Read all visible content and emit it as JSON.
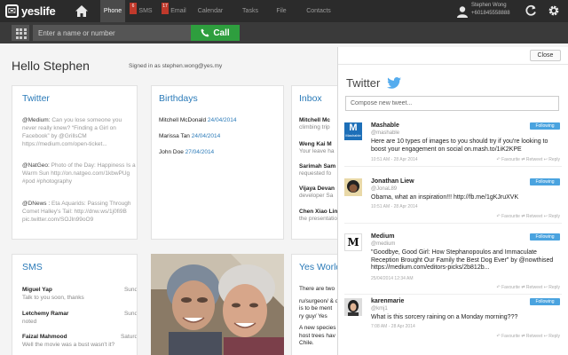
{
  "app": {
    "logo_glyph": "✉",
    "logo_text": "yeslife"
  },
  "nav": {
    "tabs": [
      {
        "label": "Phone",
        "active": true
      },
      {
        "label": "SMS",
        "badge": "6"
      },
      {
        "label": "Email",
        "badge": "17"
      },
      {
        "label": "Calendar"
      },
      {
        "label": "Tasks"
      },
      {
        "label": "File"
      },
      {
        "label": "Contacts"
      }
    ],
    "user_name": "Stephen Wong",
    "user_phone": "+601845558888"
  },
  "callbar": {
    "placeholder": "Enter a name or number",
    "call_label": "Call"
  },
  "greeting": {
    "hello": "Hello Stephen",
    "signed_in": "Signed in as stephen.wong@yes.my"
  },
  "twitter_card": {
    "title": "Twitter",
    "items": [
      {
        "handle": "@Medium:",
        "text": "Can you lose someone you never really knew? “Finding a Girl on Facebook” by @GrillsCM https://medium.com/open-ticket..."
      },
      {
        "handle": "@NatGeo:",
        "text": "Photo of the Day: Happiness Is a Warm Sun http://on.natgeo.com/1kbwPUg #pod #photography"
      },
      {
        "handle": "@DNews :",
        "text": "Eta Aquarids: Passing Through Comet Halley's Tail: http://dnw.ws/1j0fi9B pic.twitter.com/SOJln99oO9"
      }
    ]
  },
  "birthdays": {
    "title": "Birthdays",
    "rows": [
      {
        "name": "Mitchell McDonald",
        "date": "24/04/2014"
      },
      {
        "name": "Marissa Tan",
        "date": "24/04/2014"
      },
      {
        "name": "John Doe",
        "date": "27/04/2014"
      }
    ]
  },
  "inbox": {
    "title": "Inbox",
    "rows": [
      {
        "name": "Mitchell Mc",
        "msg": "climbing trip"
      },
      {
        "name": "Weng Kai M",
        "msg": "Your leave ha"
      },
      {
        "name": "Sarimah Sam",
        "msg": "requested fo"
      },
      {
        "name": "Vijaya Devan",
        "msg": "developer Sa"
      },
      {
        "name": "Chen Xiao Lin",
        "msg": "the presentatio"
      }
    ]
  },
  "sms": {
    "title": "SMS",
    "rows": [
      {
        "name": "Miguel Yap",
        "day": "Sunday",
        "msg": "Talk to you soon, thanks"
      },
      {
        "name": "Letchemy Ramar",
        "day": "Sunday",
        "msg": "noted"
      },
      {
        "name": "Faizal Mahmood",
        "day": "Saturday",
        "msg": "Well the movie was a bust wasn't it?"
      }
    ]
  },
  "yes_world": {
    "title": "Yes World",
    "lines": [
      "There are two",
      "ru/surgeon/ & d",
      "is to be ment",
      "ry guy/ Yes",
      "A new species h",
      "host trees hav",
      "Chile."
    ]
  },
  "twitter_panel": {
    "close_label": "Close",
    "title": "Twitter",
    "compose_placeholder": "Compose new tweet...",
    "follow_label": "Following",
    "actions": "↶ Favourite   ⇄ Retweet   ↩ Reply",
    "tweets": [
      {
        "avatar_label": "Mashable",
        "name": "Mashable",
        "handle": "@mashable",
        "text": "Here are 10 types of images to you should try if you're looking to boost your engagement on social on.mash.to/1iK2KPE",
        "time": "10:51 AM - 28 Apr 2014"
      },
      {
        "name": "Jonathan Liew",
        "handle": "@JonaL89",
        "text": "Obama, what an inspiration!!! http://fb.me/1gKJruXVK",
        "time": "10:51 AM - 28 Apr 2014"
      },
      {
        "avatar_label": "M",
        "name": "Medium",
        "handle": "@medium",
        "text": "\"Goodbye, Good Girl: How Stephanopoulos and Immaculate Reception Brought Our Family the Best Dog Ever\" by @nowthised https://medium.com/editors-picks/2b812b...",
        "time": "25/04/2014 12:34 AM"
      },
      {
        "name": "karenmarie",
        "handle": "@kmj1",
        "text": "What is this sorcery raining on a Monday morning???",
        "time": "7:08 AM - 28 Apr 2014"
      }
    ]
  },
  "colors": {
    "accent": "#2a7ab8",
    "call_green": "#2e9e3e",
    "badge_red": "#c0392b",
    "follow_blue": "#4aa3df"
  }
}
